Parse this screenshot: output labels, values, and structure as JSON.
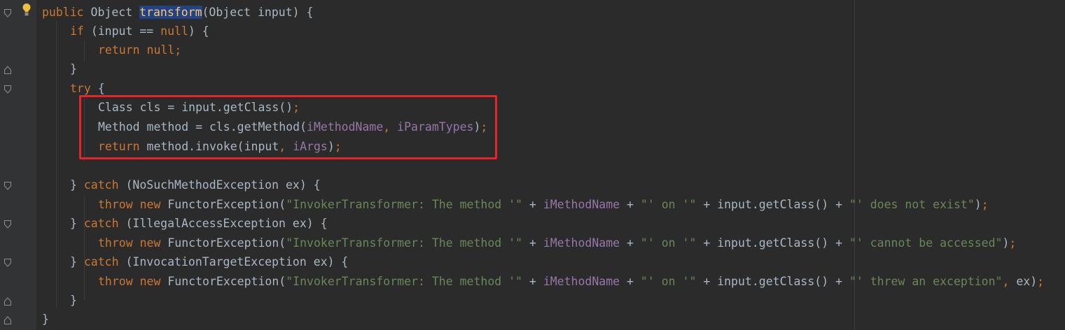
{
  "editor": {
    "lines": [
      {
        "segs": [
          {
            "t": "public ",
            "c": "kw"
          },
          {
            "t": "Object ",
            "c": "plain"
          },
          {
            "t": "transform",
            "c": "fnhl"
          },
          {
            "t": "(Object input) {",
            "c": "plain"
          }
        ]
      },
      {
        "segs": [
          {
            "t": "if ",
            "c": "kw"
          },
          {
            "t": "(input == ",
            "c": "plain"
          },
          {
            "t": "null",
            "c": "kw"
          },
          {
            "t": ") {",
            "c": "plain"
          }
        ]
      },
      {
        "segs": [
          {
            "t": "return null",
            "c": "kw"
          },
          {
            "t": ";",
            "c": "kw"
          }
        ]
      },
      {
        "segs": [
          {
            "t": "}",
            "c": "plain"
          }
        ]
      },
      {
        "segs": [
          {
            "t": "try ",
            "c": "kw"
          },
          {
            "t": "{",
            "c": "plain"
          }
        ]
      },
      {
        "segs": [
          {
            "t": "Class cls = input.getClass()",
            "c": "plain"
          },
          {
            "t": ";",
            "c": "kw"
          }
        ]
      },
      {
        "segs": [
          {
            "t": "Method method = cls.getMethod(",
            "c": "plain"
          },
          {
            "t": "iMethodName",
            "c": "fld"
          },
          {
            "t": ", ",
            "c": "kw"
          },
          {
            "t": "iParamTypes",
            "c": "fld"
          },
          {
            "t": ")",
            "c": "plain"
          },
          {
            "t": ";",
            "c": "kw"
          }
        ]
      },
      {
        "segs": [
          {
            "t": "return ",
            "c": "kw"
          },
          {
            "t": "method.invoke(input",
            "c": "plain"
          },
          {
            "t": ", ",
            "c": "kw"
          },
          {
            "t": "iArgs",
            "c": "fld"
          },
          {
            "t": ")",
            "c": "plain"
          },
          {
            "t": ";",
            "c": "kw"
          }
        ]
      },
      {
        "segs": []
      },
      {
        "segs": [
          {
            "t": "} ",
            "c": "plain"
          },
          {
            "t": "catch ",
            "c": "kw"
          },
          {
            "t": "(NoSuchMethodException ex) {",
            "c": "plain"
          }
        ]
      },
      {
        "segs": [
          {
            "t": "throw new ",
            "c": "kw"
          },
          {
            "t": "FunctorException(",
            "c": "plain"
          },
          {
            "t": "\"InvokerTransformer: The method '\"",
            "c": "str"
          },
          {
            "t": " + ",
            "c": "plain"
          },
          {
            "t": "iMethodName",
            "c": "fld"
          },
          {
            "t": " + ",
            "c": "plain"
          },
          {
            "t": "\"' on '\"",
            "c": "str"
          },
          {
            "t": " + input.getClass() + ",
            "c": "plain"
          },
          {
            "t": "\"' does not exist\"",
            "c": "str"
          },
          {
            "t": ")",
            "c": "plain"
          },
          {
            "t": ";",
            "c": "kw"
          }
        ]
      },
      {
        "segs": [
          {
            "t": "} ",
            "c": "plain"
          },
          {
            "t": "catch ",
            "c": "kw"
          },
          {
            "t": "(IllegalAccessException ex) {",
            "c": "plain"
          }
        ]
      },
      {
        "segs": [
          {
            "t": "throw new ",
            "c": "kw"
          },
          {
            "t": "FunctorException(",
            "c": "plain"
          },
          {
            "t": "\"InvokerTransformer: The method '\"",
            "c": "str"
          },
          {
            "t": " + ",
            "c": "plain"
          },
          {
            "t": "iMethodName",
            "c": "fld"
          },
          {
            "t": " + ",
            "c": "plain"
          },
          {
            "t": "\"' on '\"",
            "c": "str"
          },
          {
            "t": " + input.getClass() + ",
            "c": "plain"
          },
          {
            "t": "\"' cannot be accessed\"",
            "c": "str"
          },
          {
            "t": ")",
            "c": "plain"
          },
          {
            "t": ";",
            "c": "kw"
          }
        ]
      },
      {
        "segs": [
          {
            "t": "} ",
            "c": "plain"
          },
          {
            "t": "catch ",
            "c": "kw"
          },
          {
            "t": "(InvocationTargetException ex) {",
            "c": "plain"
          }
        ]
      },
      {
        "segs": [
          {
            "t": "throw new ",
            "c": "kw"
          },
          {
            "t": "FunctorException(",
            "c": "plain"
          },
          {
            "t": "\"InvokerTransformer: The method '\"",
            "c": "str"
          },
          {
            "t": " + ",
            "c": "plain"
          },
          {
            "t": "iMethodName",
            "c": "fld"
          },
          {
            "t": " + ",
            "c": "plain"
          },
          {
            "t": "\"' on '\"",
            "c": "str"
          },
          {
            "t": " + input.getClass() + ",
            "c": "plain"
          },
          {
            "t": "\"' threw an exception\"",
            "c": "str"
          },
          {
            "t": ", ",
            "c": "kw"
          },
          {
            "t": "ex)",
            "c": "plain"
          },
          {
            "t": ";",
            "c": "kw"
          }
        ]
      },
      {
        "segs": [
          {
            "t": "}",
            "c": "plain"
          }
        ]
      },
      {
        "segs": [
          {
            "t": "}",
            "c": "plain"
          }
        ]
      }
    ]
  },
  "theme": {
    "background": "#2b2b2b",
    "keyword": "#cc7832",
    "field": "#9876aa",
    "string": "#6a8759",
    "method_declaration": "#ffc66d",
    "selection": "#214283",
    "annotation_box": "#e8232c"
  },
  "gutter": {
    "intention_icon": "lightbulb-icon"
  }
}
